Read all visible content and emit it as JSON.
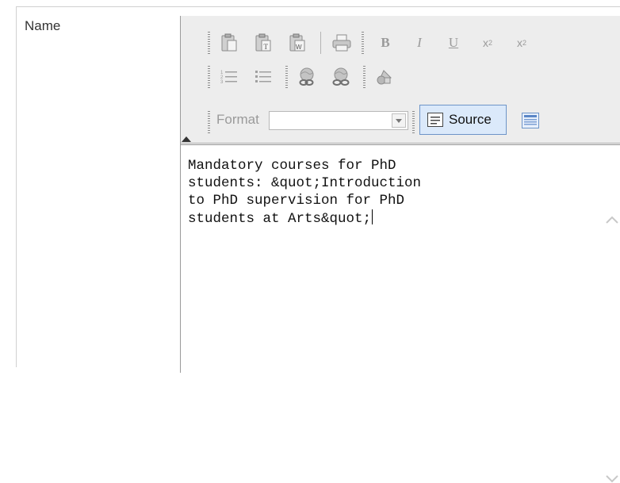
{
  "field": {
    "label": "Name"
  },
  "toolbar": {
    "buttons_row1": [
      "paste-icon",
      "paste-text-icon",
      "paste-word-icon",
      "print-icon",
      "bold-button",
      "italic-button",
      "underline-button",
      "subscript-button",
      "superscript-button"
    ],
    "bold_label": "B",
    "italic_label": "I",
    "underline_label": "U",
    "subscript_label": "x",
    "subscript_mark": "2",
    "superscript_label": "x",
    "superscript_mark": "2",
    "buttons_row2": [
      "numbered-list-icon",
      "bulleted-list-icon",
      "link-icon",
      "unlink-icon",
      "image-icon"
    ],
    "format_label": "Format",
    "format_value": "",
    "source_label": "Source",
    "colors": {
      "toolbar_bg": "#ededed",
      "source_active_bg": "#dbe9fa",
      "source_active_border": "#6d94c8"
    }
  },
  "editor": {
    "content": "Mandatory courses for PhD students: &quot;Introduction to PhD supervision for PhD students at Arts&quot;"
  }
}
